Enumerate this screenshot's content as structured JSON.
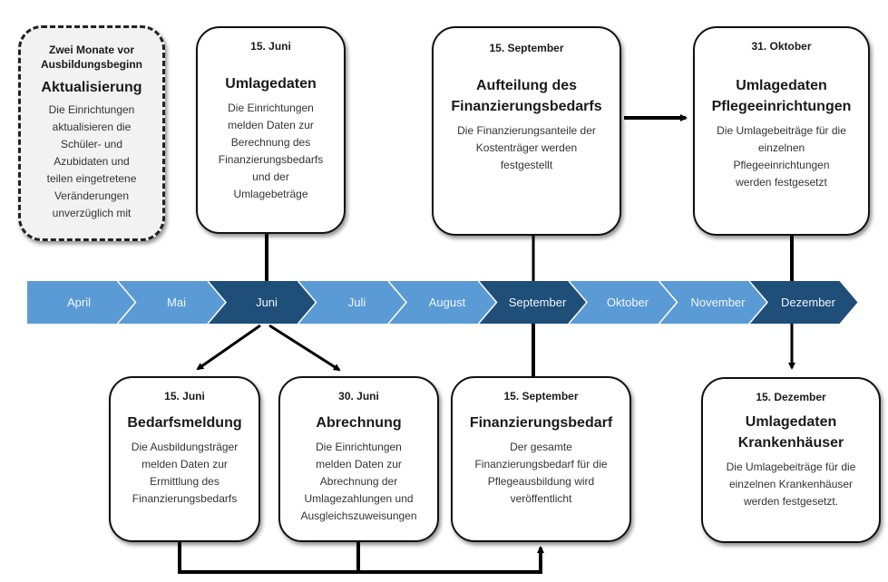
{
  "timeline": {
    "months": [
      {
        "label": "April",
        "highlight": false
      },
      {
        "label": "Mai",
        "highlight": false
      },
      {
        "label": "Juni",
        "highlight": true
      },
      {
        "label": "Juli",
        "highlight": false
      },
      {
        "label": "August",
        "highlight": false
      },
      {
        "label": "September",
        "highlight": true
      },
      {
        "label": "Oktober",
        "highlight": false
      },
      {
        "label": "November",
        "highlight": false
      },
      {
        "label": "Dezember",
        "highlight": true
      }
    ],
    "colors": {
      "normal": "#5B9BD5",
      "highlight": "#1F4E79",
      "separator": "#ffffff"
    }
  },
  "boxes": {
    "aktualisierung": {
      "date": "Zwei Monate vor Ausbildungsbeginn",
      "title": "Aktualisierung",
      "desc": [
        "Die Einrichtungen",
        "aktualisieren die",
        "Schüler- und",
        "Azubidaten und",
        "teilen eingetretene",
        "Veränderungen",
        "unverzüglich mit"
      ]
    },
    "umlagedaten": {
      "date": "15. Juni",
      "title": "Umlagedaten",
      "desc": [
        "Die Einrichtungen",
        "melden Daten zur",
        "Berechnung des",
        "Finanzierungsbedarfs",
        "und der",
        "Umlagebeträge"
      ]
    },
    "aufteilung": {
      "date": "15. September",
      "title": [
        "Aufteilung des",
        "Finanzierungsbedarfs"
      ],
      "desc": [
        "Die Finanzierungsanteile der",
        "Kostenträger werden",
        "festgestellt"
      ]
    },
    "pflegeeinrichtungen": {
      "date": "31. Oktober",
      "title": [
        "Umlagedaten",
        "Pflegeeinrichtungen"
      ],
      "desc": [
        "Die Umlagebeiträge für die",
        "einzelnen",
        "Pflegeeinrichtungen",
        "werden festgesetzt"
      ]
    },
    "bedarfsmeldung": {
      "date": "15. Juni",
      "title": "Bedarfsmeldung",
      "desc": [
        "Die Ausbildungsträger",
        "melden Daten zur",
        "Ermittlung des",
        "Finanzierungsbedarfs"
      ]
    },
    "abrechnung": {
      "date": "30. Juni",
      "title": "Abrechnung",
      "desc": [
        "Die Einrichtungen",
        "melden Daten zur",
        "Abrechnung der",
        "Umlagezahlungen und",
        "Ausgleichszuweisungen"
      ]
    },
    "finanzierungsbedarf": {
      "date": "15. September",
      "title": "Finanzierungsbedarf",
      "desc": [
        "Der gesamte",
        "Finanzierungsbedarf für die",
        "Pflegeausbildung wird",
        "veröffentlicht"
      ]
    },
    "krankenhaeuser": {
      "date": "15. Dezember",
      "title": [
        "Umlagedaten",
        "Krankenhäuser"
      ],
      "desc": [
        "Die Umlagebeiträge für die",
        "einzelnen Krankenhäuser",
        "werden festgesetzt."
      ]
    }
  }
}
